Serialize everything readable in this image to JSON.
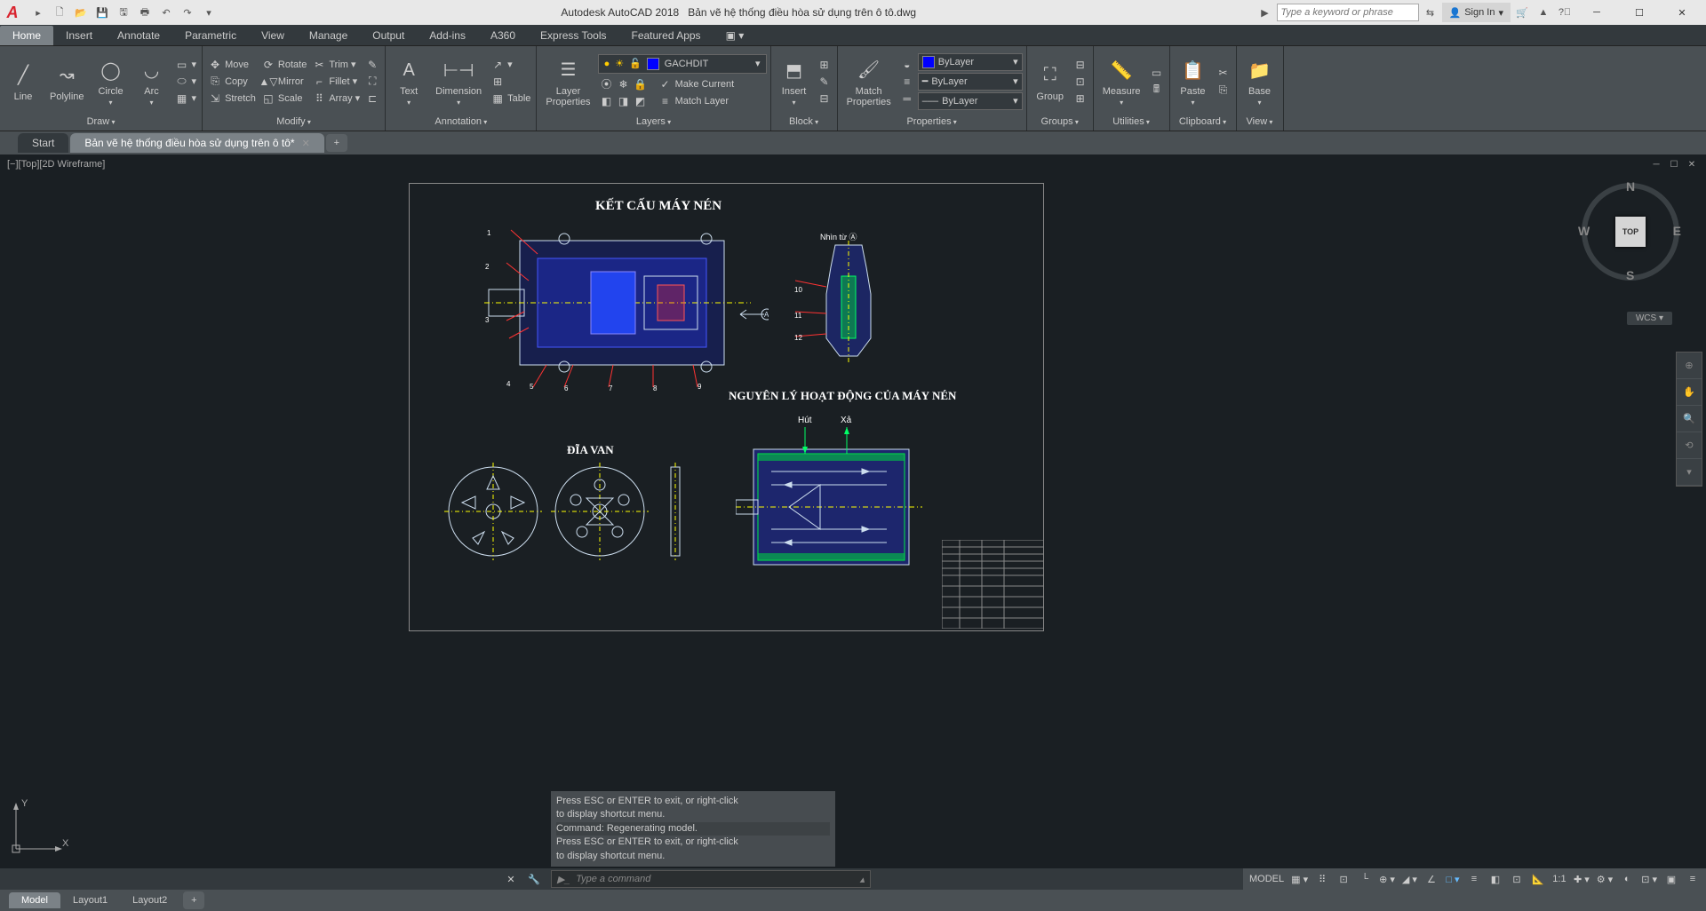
{
  "title": {
    "app": "Autodesk AutoCAD 2018",
    "file": "Bản vẽ hệ thống điều hòa sử dụng trên ô tô.dwg"
  },
  "search": {
    "placeholder": "Type a keyword or phrase"
  },
  "signin": "Sign In",
  "ribbon": {
    "tabs": [
      "Home",
      "Insert",
      "Annotate",
      "Parametric",
      "View",
      "Manage",
      "Output",
      "Add-ins",
      "A360",
      "Express Tools",
      "Featured Apps"
    ],
    "draw": {
      "title": "Draw",
      "line": "Line",
      "polyline": "Polyline",
      "circle": "Circle",
      "arc": "Arc"
    },
    "modify": {
      "title": "Modify",
      "move": "Move",
      "rotate": "Rotate",
      "trim": "Trim",
      "copy": "Copy",
      "mirror": "Mirror",
      "fillet": "Fillet",
      "stretch": "Stretch",
      "scale": "Scale",
      "array": "Array"
    },
    "annotation": {
      "title": "Annotation",
      "text": "Text",
      "dimension": "Dimension",
      "table": "Table"
    },
    "layers": {
      "title": "Layers",
      "props": "Layer\nProperties",
      "current": "GACHDIT",
      "make_current": "Make Current",
      "match": "Match Layer"
    },
    "block": {
      "title": "Block",
      "insert": "Insert"
    },
    "properties": {
      "title": "Properties",
      "match": "Match\nProperties",
      "bylayer": "ByLayer"
    },
    "groups": {
      "title": "Groups",
      "group": "Group"
    },
    "utilities": {
      "title": "Utilities",
      "measure": "Measure"
    },
    "clipboard": {
      "title": "Clipboard",
      "paste": "Paste"
    },
    "view": {
      "title": "View",
      "base": "Base"
    }
  },
  "file_tabs": {
    "start": "Start",
    "current": "Bản vẽ hệ thống điều hòa sử dụng trên ô tô*"
  },
  "viewport": {
    "label": "[−][Top][2D Wireframe]"
  },
  "drawing": {
    "title1": "KẾT CẤU MÁY NÉN",
    "title2": "NGUYÊN LÝ HOẠT ĐỘNG CỦA MÁY NÉN",
    "title3": "ĐĨA VAN",
    "nhin": "Nhìn từ Ⓐ",
    "hut": "Hút",
    "xa": "Xả",
    "callouts": [
      "1",
      "2",
      "3",
      "4",
      "5",
      "6",
      "7",
      "8",
      "9",
      "10",
      "11",
      "12"
    ]
  },
  "viewcube": {
    "top": "TOP",
    "n": "N",
    "s": "S",
    "e": "E",
    "w": "W",
    "wcs": "WCS ▾"
  },
  "cmd": {
    "h1": "Press ESC or ENTER to exit, or right-click",
    "h2": "to display shortcut menu.",
    "h3": "Command: Regenerating model.",
    "h4": "Press ESC or ENTER to exit, or right-click",
    "h5": "to display shortcut menu.",
    "placeholder": "Type a command"
  },
  "layout_tabs": [
    "Model",
    "Layout1",
    "Layout2"
  ],
  "status": {
    "model": "MODEL",
    "scale": "1:1"
  }
}
